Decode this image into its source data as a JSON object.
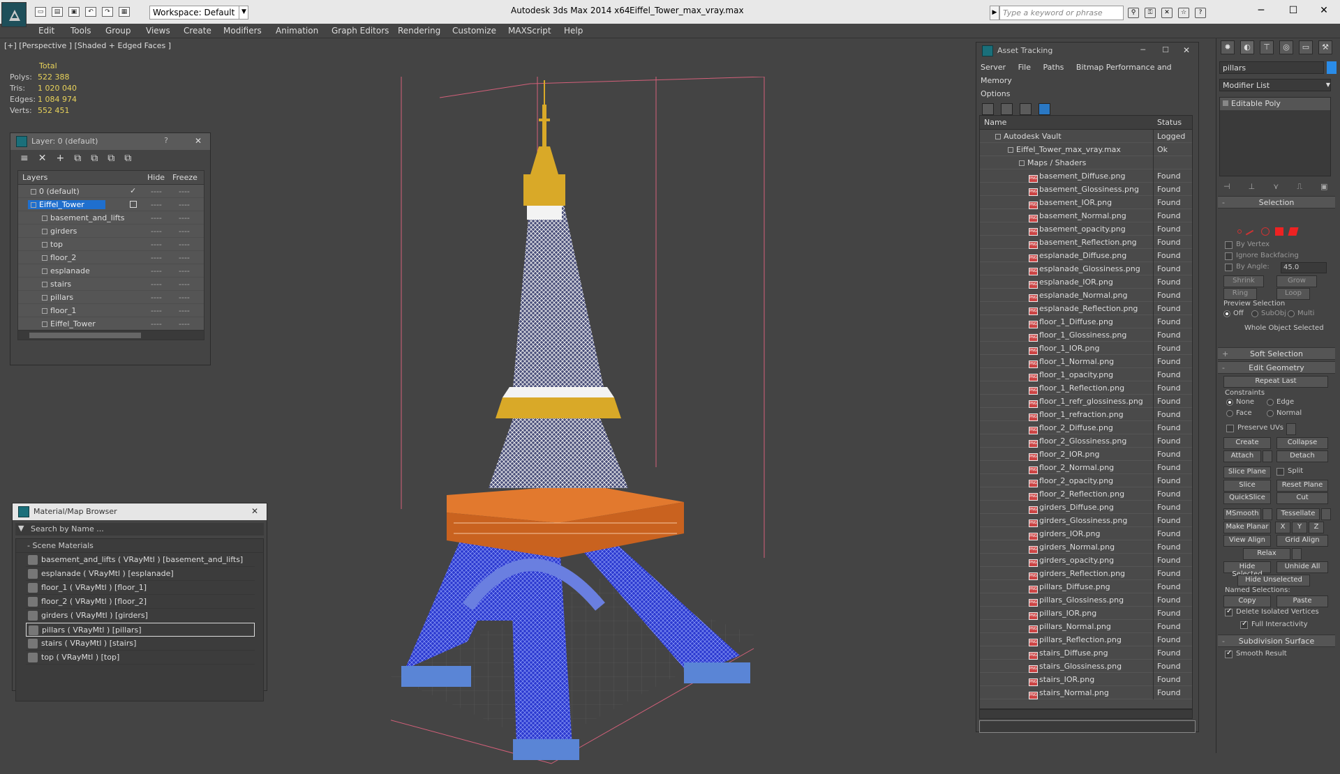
{
  "titlebar": {
    "workspace": "Workspace: Default",
    "app_title": "Autodesk 3ds Max  2014 x64",
    "file_title": "Eiffel_Tower_max_vray.max",
    "search_placeholder": "Type a keyword or phrase"
  },
  "menu": [
    "Edit",
    "Tools",
    "Group",
    "Views",
    "Create",
    "Modifiers",
    "Animation",
    "Graph Editors",
    "Rendering",
    "Customize",
    "MAXScript",
    "Help"
  ],
  "viewport": {
    "label": "[+] [Perspective ] [Shaded + Edged Faces ]",
    "stats_header": "Total",
    "stats": [
      {
        "k": "Polys:",
        "v": "522 388"
      },
      {
        "k": "Tris:",
        "v": "1 020 040"
      },
      {
        "k": "Edges:",
        "v": "1 084 974"
      },
      {
        "k": "Verts:",
        "v": "552 451"
      }
    ]
  },
  "layer_panel": {
    "title": "Layer: 0 (default)",
    "help": "?",
    "col_layers": "Layers",
    "col_hide": "Hide",
    "col_freeze": "Freeze",
    "rows": [
      {
        "name": "0 (default)",
        "level": 0,
        "check": "✓"
      },
      {
        "name": "Eiffel_Tower",
        "level": 0,
        "selected": true
      },
      {
        "name": "basement_and_lifts",
        "level": 1
      },
      {
        "name": "girders",
        "level": 1
      },
      {
        "name": "top",
        "level": 1
      },
      {
        "name": "floor_2",
        "level": 1
      },
      {
        "name": "esplanade",
        "level": 1
      },
      {
        "name": "stairs",
        "level": 1
      },
      {
        "name": "pillars",
        "level": 1
      },
      {
        "name": "floor_1",
        "level": 1
      },
      {
        "name": "Eiffel_Tower",
        "level": 1
      }
    ],
    "hide_mark": "----",
    "freeze_mark": "----"
  },
  "material_browser": {
    "title": "Material/Map Browser",
    "search_placeholder": "Search by Name ...",
    "group": "- Scene Materials",
    "items": [
      {
        "label": "basement_and_lifts  ( VRayMtl )  [basement_and_lifts]"
      },
      {
        "label": "esplanade  ( VRayMtl )  [esplanade]"
      },
      {
        "label": "floor_1  ( VRayMtl )  [floor_1]"
      },
      {
        "label": "floor_2  ( VRayMtl )  [floor_2]"
      },
      {
        "label": "girders  ( VRayMtl )  [girders]"
      },
      {
        "label": "pillars  ( VRayMtl )  [pillars]",
        "selected": true
      },
      {
        "label": "stairs  ( VRayMtl )  [stairs]"
      },
      {
        "label": "top  ( VRayMtl )  [top]"
      }
    ]
  },
  "asset_tracking": {
    "title": "Asset Tracking",
    "menu": [
      "Server",
      "File",
      "Paths",
      "Bitmap Performance and Memory"
    ],
    "menu2": "Options",
    "col_name": "Name",
    "col_status": "Status",
    "rows": [
      {
        "name": "Autodesk Vault",
        "status": "Logged",
        "level": 0
      },
      {
        "name": "Eiffel_Tower_max_vray.max",
        "status": "Ok",
        "level": 1
      },
      {
        "name": "Maps / Shaders",
        "status": "",
        "level": 2
      },
      {
        "name": "basement_Diffuse.png",
        "status": "Found",
        "level": 3
      },
      {
        "name": "basement_Glossiness.png",
        "status": "Found",
        "level": 3
      },
      {
        "name": "basement_IOR.png",
        "status": "Found",
        "level": 3
      },
      {
        "name": "basement_Normal.png",
        "status": "Found",
        "level": 3
      },
      {
        "name": "basement_opacity.png",
        "status": "Found",
        "level": 3
      },
      {
        "name": "basement_Reflection.png",
        "status": "Found",
        "level": 3
      },
      {
        "name": "esplanade_Diffuse.png",
        "status": "Found",
        "level": 3
      },
      {
        "name": "esplanade_Glossiness.png",
        "status": "Found",
        "level": 3
      },
      {
        "name": "esplanade_IOR.png",
        "status": "Found",
        "level": 3
      },
      {
        "name": "esplanade_Normal.png",
        "status": "Found",
        "level": 3
      },
      {
        "name": "esplanade_Reflection.png",
        "status": "Found",
        "level": 3
      },
      {
        "name": "floor_1_Diffuse.png",
        "status": "Found",
        "level": 3
      },
      {
        "name": "floor_1_Glossiness.png",
        "status": "Found",
        "level": 3
      },
      {
        "name": "floor_1_IOR.png",
        "status": "Found",
        "level": 3
      },
      {
        "name": "floor_1_Normal.png",
        "status": "Found",
        "level": 3
      },
      {
        "name": "floor_1_opacity.png",
        "status": "Found",
        "level": 3
      },
      {
        "name": "floor_1_Reflection.png",
        "status": "Found",
        "level": 3
      },
      {
        "name": "floor_1_refr_glossiness.png",
        "status": "Found",
        "level": 3
      },
      {
        "name": "floor_1_refraction.png",
        "status": "Found",
        "level": 3
      },
      {
        "name": "floor_2_Diffuse.png",
        "status": "Found",
        "level": 3
      },
      {
        "name": "floor_2_Glossiness.png",
        "status": "Found",
        "level": 3
      },
      {
        "name": "floor_2_IOR.png",
        "status": "Found",
        "level": 3
      },
      {
        "name": "floor_2_Normal.png",
        "status": "Found",
        "level": 3
      },
      {
        "name": "floor_2_opacity.png",
        "status": "Found",
        "level": 3
      },
      {
        "name": "floor_2_Reflection.png",
        "status": "Found",
        "level": 3
      },
      {
        "name": "girders_Diffuse.png",
        "status": "Found",
        "level": 3
      },
      {
        "name": "girders_Glossiness.png",
        "status": "Found",
        "level": 3
      },
      {
        "name": "girders_IOR.png",
        "status": "Found",
        "level": 3
      },
      {
        "name": "girders_Normal.png",
        "status": "Found",
        "level": 3
      },
      {
        "name": "girders_opacity.png",
        "status": "Found",
        "level": 3
      },
      {
        "name": "girders_Reflection.png",
        "status": "Found",
        "level": 3
      },
      {
        "name": "pillars_Diffuse.png",
        "status": "Found",
        "level": 3
      },
      {
        "name": "pillars_Glossiness.png",
        "status": "Found",
        "level": 3
      },
      {
        "name": "pillars_IOR.png",
        "status": "Found",
        "level": 3
      },
      {
        "name": "pillars_Normal.png",
        "status": "Found",
        "level": 3
      },
      {
        "name": "pillars_Reflection.png",
        "status": "Found",
        "level": 3
      },
      {
        "name": "stairs_Diffuse.png",
        "status": "Found",
        "level": 3
      },
      {
        "name": "stairs_Glossiness.png",
        "status": "Found",
        "level": 3
      },
      {
        "name": "stairs_IOR.png",
        "status": "Found",
        "level": 3
      },
      {
        "name": "stairs_Normal.png",
        "status": "Found",
        "level": 3
      }
    ]
  },
  "command_panel": {
    "object_name": "pillars",
    "object_color": "#2a8ce8",
    "modifier_list": "Modifier List",
    "stack_item": "Editable Poly",
    "rollouts": {
      "selection": "Selection",
      "soft_selection": "Soft Selection",
      "edit_geometry": "Edit Geometry",
      "subdivision_surface": "Subdivision Surface"
    },
    "selection": {
      "by_vertex": "By Vertex",
      "ignore_backfacing": "Ignore Backfacing",
      "by_angle": "By Angle:",
      "angle_value": "45.0",
      "shrink": "Shrink",
      "grow": "Grow",
      "ring": "Ring",
      "loop": "Loop",
      "preview_selection": "Preview Selection",
      "off": "Off",
      "subobj": "SubObj",
      "multi": "Multi",
      "status": "Whole Object Selected"
    },
    "edit_geometry": {
      "repeat_last": "Repeat Last",
      "constraints": "Constraints",
      "none": "None",
      "edge": "Edge",
      "face": "Face",
      "normal": "Normal",
      "preserve_uvs": "Preserve UVs",
      "create": "Create",
      "collapse": "Collapse",
      "attach": "Attach",
      "detach": "Detach",
      "slice_plane": "Slice Plane",
      "split": "Split",
      "slice": "Slice",
      "reset_plane": "Reset Plane",
      "quickslice": "QuickSlice",
      "cut": "Cut",
      "msmooth": "MSmooth",
      "tessellate": "Tessellate",
      "make_planar": "Make Planar",
      "x": "X",
      "y": "Y",
      "z": "Z",
      "view_align": "View Align",
      "grid_align": "Grid Align",
      "relax": "Relax",
      "hide_selected": "Hide Selected",
      "unhide_all": "Unhide All",
      "hide_unselected": "Hide Unselected",
      "named_selections": "Named Selections:",
      "copy": "Copy",
      "paste": "Paste",
      "delete_isolated": "Delete Isolated Vertices",
      "full_interactivity": "Full Interactivity"
    },
    "subdivision": {
      "smooth_result": "Smooth Result"
    }
  },
  "colors": {
    "selection_blue": "#1f6fce",
    "stat_yellow": "#e8d25a",
    "tower_blue": "#2a3fd8",
    "tower_orange": "#e2792e",
    "tower_gold": "#d9a928",
    "bbox_pink": "#d4607a"
  }
}
